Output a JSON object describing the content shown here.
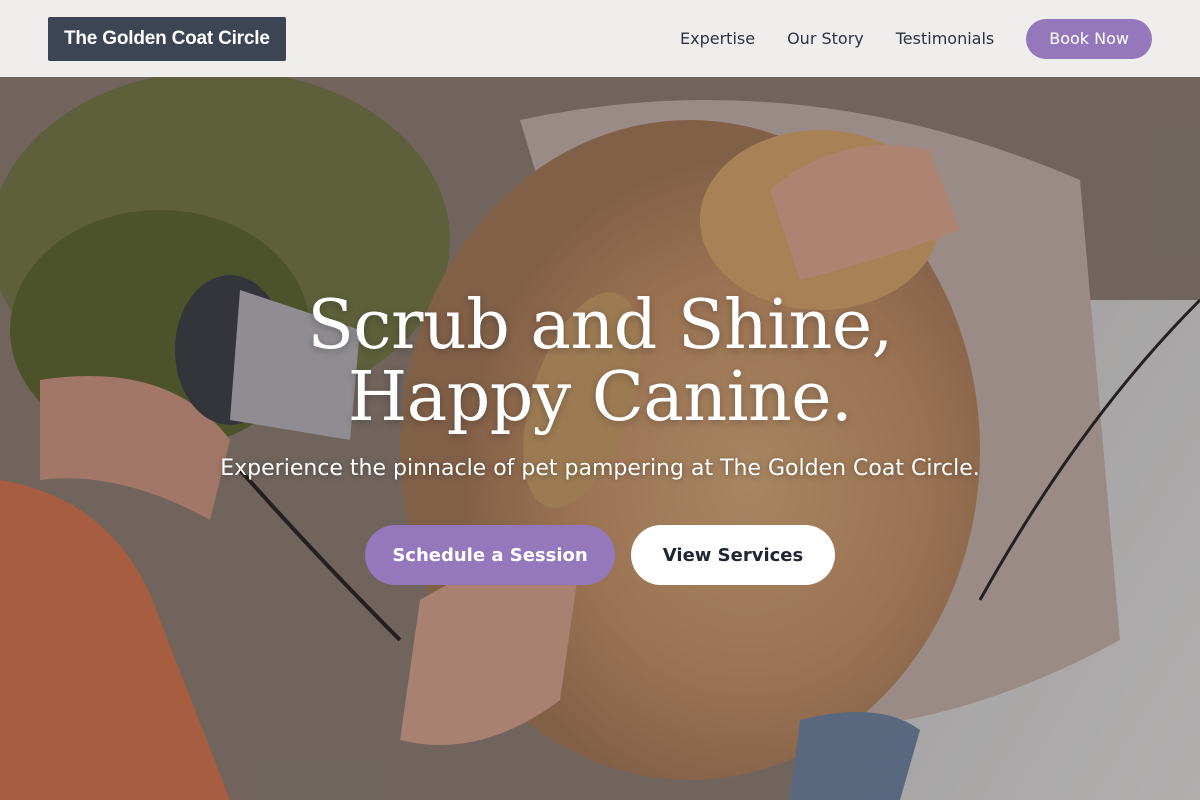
{
  "brand": {
    "name": "The Golden Coat Circle"
  },
  "nav": {
    "links": [
      {
        "label": "Expertise"
      },
      {
        "label": "Our Story"
      },
      {
        "label": "Testimonials"
      }
    ],
    "cta_label": "Book Now"
  },
  "hero": {
    "title_line1": "Scrub and Shine,",
    "title_line2": "Happy Canine.",
    "subtitle": "Experience the pinnacle of pet pampering at The Golden Coat Circle.",
    "primary_cta": "Schedule a Session",
    "secondary_cta": "View Services"
  },
  "colors": {
    "accent": "#9478bb",
    "logo_bg": "#3d4454",
    "nav_text": "#2d3342",
    "button_light_bg": "#ffffff"
  }
}
